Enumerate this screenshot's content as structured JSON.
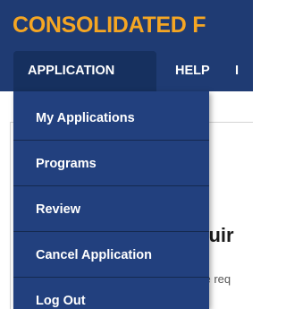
{
  "header": {
    "brand": "CONSOLIDATED F"
  },
  "nav": {
    "tabs": [
      {
        "label": "APPLICATION"
      },
      {
        "label": "HELP"
      },
      {
        "label": "I"
      }
    ]
  },
  "dropdown": {
    "items": [
      {
        "label": "My Applications"
      },
      {
        "label": "Programs"
      },
      {
        "label": "Review"
      },
      {
        "label": "Cancel Application"
      },
      {
        "label": "Log Out"
      }
    ]
  },
  "content": {
    "heading_fragment": "quir",
    "subtext_fragment": "ite req"
  },
  "colors": {
    "header_bg": "#1f3b73",
    "brand_accent": "#f5a623",
    "menu_bg": "#22407e",
    "active_tab_bg": "#16305f"
  }
}
